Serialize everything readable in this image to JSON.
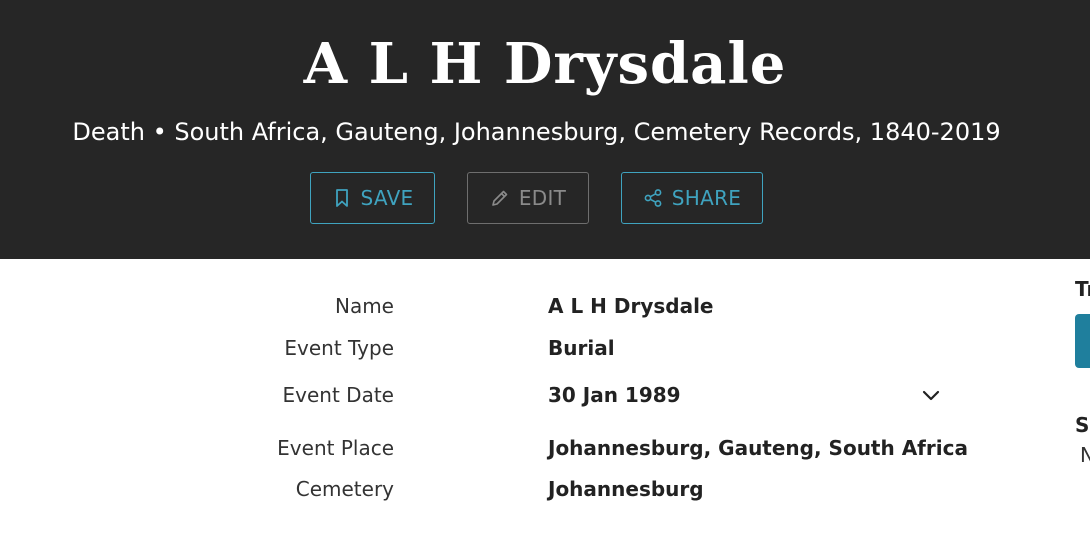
{
  "header": {
    "title": "A L H Drysdale",
    "subtitle": "Death • South Africa, Gauteng, Johannesburg, Cemetery Records, 1840-2019",
    "buttons": {
      "save": "SAVE",
      "edit": "EDIT",
      "share": "SHARE"
    }
  },
  "details": [
    {
      "label": "Name",
      "value": "A L H Drysdale"
    },
    {
      "label": "Event Type",
      "value": "Burial"
    },
    {
      "label": "Event Date",
      "value": "30 Jan 1989"
    },
    {
      "label": "Event Place",
      "value": "Johannesburg, Gauteng, South Africa"
    },
    {
      "label": "Cemetery",
      "value": "Johannesburg"
    }
  ],
  "sidebar": {
    "heading_partial": "Tr",
    "section_partial": "Si",
    "text_partial": "N"
  },
  "colors": {
    "header_bg": "#262626",
    "accent": "#3fa3bf",
    "disabled": "#8a8a8a"
  },
  "icons": [
    "bookmark-icon",
    "pencil-icon",
    "share-icon",
    "chevron-down-icon"
  ]
}
